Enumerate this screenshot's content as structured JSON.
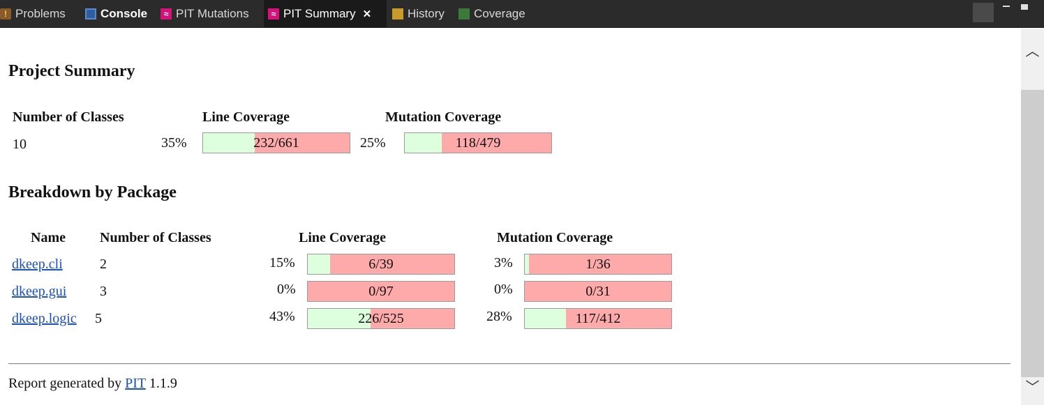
{
  "tabs": [
    {
      "label": "Problems",
      "icon": "problems-icon"
    },
    {
      "label": "Console",
      "icon": "console-icon"
    },
    {
      "label": "PIT Mutations",
      "icon": "pit-icon"
    },
    {
      "label": "PIT Summary",
      "icon": "pit-icon",
      "active": true
    },
    {
      "label": "History",
      "icon": "history-icon"
    },
    {
      "label": "Coverage",
      "icon": "coverage-icon"
    }
  ],
  "project_summary": {
    "heading": "Project Summary",
    "headers": {
      "classes": "Number of Classes",
      "line": "Line Coverage",
      "mutation": "Mutation Coverage"
    },
    "classes": "10",
    "line": {
      "pct": "35%",
      "ratio": "232/661",
      "fraction": 0.35
    },
    "mutation": {
      "pct": "25%",
      "ratio": "118/479",
      "fraction": 0.25
    }
  },
  "breakdown": {
    "heading": "Breakdown by Package",
    "headers": {
      "name": "Name",
      "classes": "Number of Classes",
      "line": "Line Coverage",
      "mutation": "Mutation Coverage"
    },
    "rows": [
      {
        "name": "dkeep.cli",
        "classes": "2",
        "line": {
          "pct": "15%",
          "ratio": "6/39",
          "fraction": 0.15
        },
        "mutation": {
          "pct": "3%",
          "ratio": "1/36",
          "fraction": 0.03
        }
      },
      {
        "name": "dkeep.gui",
        "classes": "3",
        "line": {
          "pct": "0%",
          "ratio": "0/97",
          "fraction": 0.0
        },
        "mutation": {
          "pct": "0%",
          "ratio": "0/31",
          "fraction": 0.0
        }
      },
      {
        "name": "dkeep.logic",
        "classes": "5",
        "line": {
          "pct": "43%",
          "ratio": "226/525",
          "fraction": 0.43
        },
        "mutation": {
          "pct": "28%",
          "ratio": "117/412",
          "fraction": 0.28
        }
      }
    ]
  },
  "footer": {
    "prefix": "Report generated by",
    "link": "PIT",
    "version": "1.1.9"
  },
  "colors": {
    "covered": "#ddffdd",
    "uncovered": "#ffaaaa",
    "link": "#1a4fbf",
    "tabbar": "#2b2b2b",
    "pit_brand": "#d4127a"
  }
}
